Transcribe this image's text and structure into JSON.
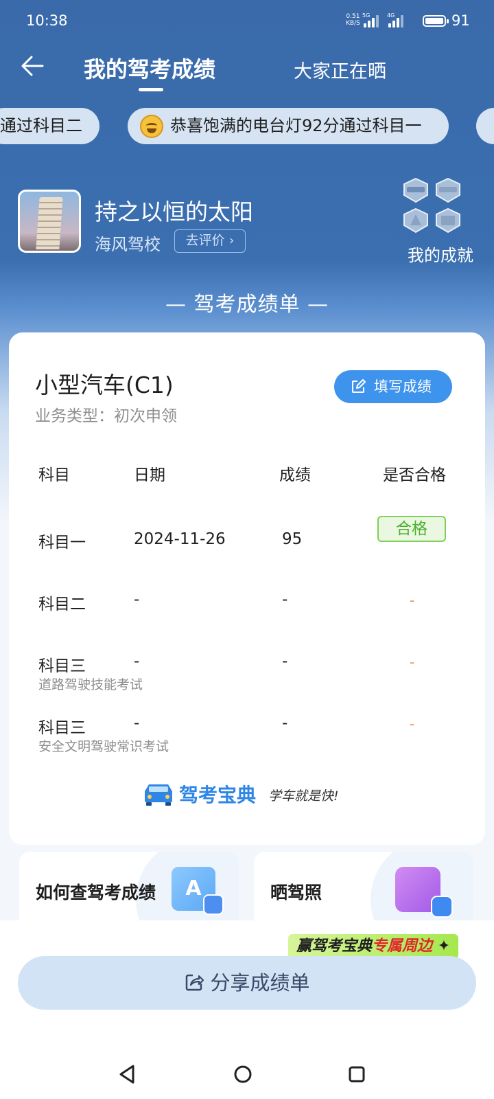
{
  "status": {
    "time": "10:38",
    "net_speed": "0.51",
    "net_unit": "KB/S",
    "sig1_label": "5G",
    "sig2_label": "4G",
    "battery": "91"
  },
  "header": {
    "tab_active": "我的驾考成绩",
    "tab_other": "大家正在晒"
  },
  "marquee": [
    {
      "text": "通过科目二"
    },
    {
      "text": "恭喜饱满的电台灯92分通过科目一"
    }
  ],
  "profile": {
    "name": "持之以恒的太阳",
    "school": "海风驾校",
    "rate_label": "去评价",
    "achievement_label": "我的成就"
  },
  "section_title": "— 驾考成绩单 —",
  "card": {
    "car_type": "小型汽车(C1)",
    "business": "业务类型：初次申领",
    "fill_button": "填写成绩",
    "columns": [
      "科目",
      "日期",
      "成绩",
      "是否合格"
    ],
    "rows": [
      {
        "subject": "科目一",
        "sub": "",
        "date": "2024-11-26",
        "score": "95",
        "result": "合格"
      },
      {
        "subject": "科目二",
        "sub": "",
        "date": "-",
        "score": "-",
        "result": "-"
      },
      {
        "subject": "科目三",
        "sub": "道路驾驶技能考试",
        "date": "-",
        "score": "-",
        "result": "-"
      },
      {
        "subject": "科目三",
        "sub": "安全文明驾驶常识考试",
        "date": "-",
        "score": "-",
        "result": "-"
      }
    ],
    "logo_text": "驾考宝典",
    "logo_slogan": "学车就是快!"
  },
  "help": {
    "query_label": "如何查驾考成绩",
    "show_label": "晒驾照"
  },
  "promo": {
    "part1": "赢驾考宝典",
    "part2": "专属周边"
  },
  "share_button": "分享成绩单",
  "colors": {
    "header_blue": "#3a6aaa",
    "accent_blue": "#3e93ec",
    "pass_green": "#4caf2d",
    "dash_orange": "#f08a3c"
  },
  "icons": [
    "back-arrow-icon",
    "edit-icon",
    "share-icon",
    "nav-back-icon",
    "nav-home-icon",
    "nav-recents-icon"
  ]
}
